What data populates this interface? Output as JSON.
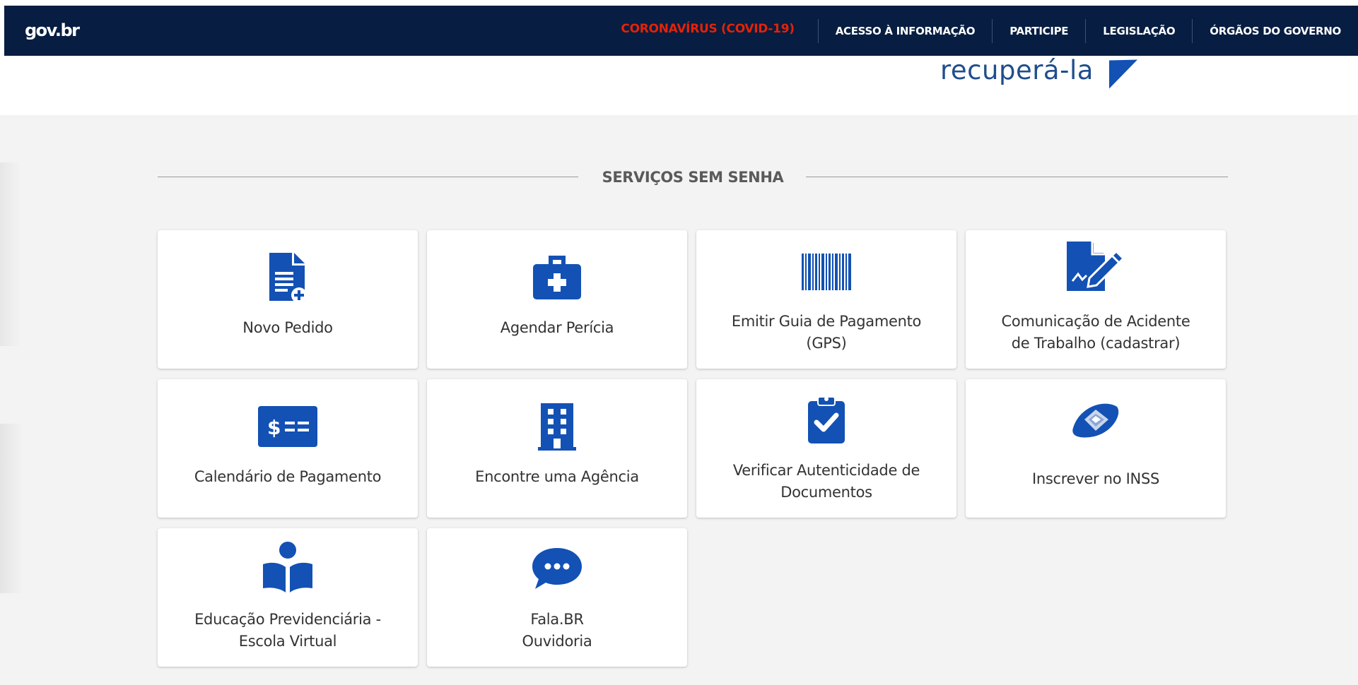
{
  "topbar": {
    "logo": "gov.br",
    "nav": {
      "covid": "CORONAVÍRUS (COVID-19)",
      "acesso": "ACESSO À INFORMAÇÃO",
      "participe": "PARTICIPE",
      "legislacao": "LEGISLAÇÃO",
      "orgaos": "ÓRGÃOS DO GOVERNO"
    }
  },
  "header": {
    "fragment": "recuperá-la"
  },
  "services": {
    "title": "SERVIÇOS SEM SENHA",
    "cards": [
      {
        "label": "Novo Pedido",
        "icon": "document-add-icon"
      },
      {
        "label": "Agendar Perícia",
        "icon": "medical-kit-icon"
      },
      {
        "label": "Emitir Guia de Pagamento\n(GPS)",
        "icon": "barcode-icon"
      },
      {
        "label": "Comunicação de Acidente\nde Trabalho (cadastrar)",
        "icon": "document-sign-icon"
      },
      {
        "label": "Calendário de Pagamento",
        "icon": "money-bill-icon"
      },
      {
        "label": "Encontre uma Agência",
        "icon": "building-icon"
      },
      {
        "label": "Verificar Autenticidade de\nDocumentos",
        "icon": "clipboard-check-icon"
      },
      {
        "label": "Inscrever no INSS",
        "icon": "inss-logo-icon"
      },
      {
        "label": "Educação Previdenciária -\nEscola Virtual",
        "icon": "reader-icon"
      },
      {
        "label": "Fala.BR\nOuvidoria",
        "icon": "chat-bubble-icon"
      }
    ]
  },
  "colors": {
    "navbar": "#071d41",
    "alert": "#e52207",
    "icon_blue": "#1351b4",
    "section_bg": "#f3f3f3"
  }
}
